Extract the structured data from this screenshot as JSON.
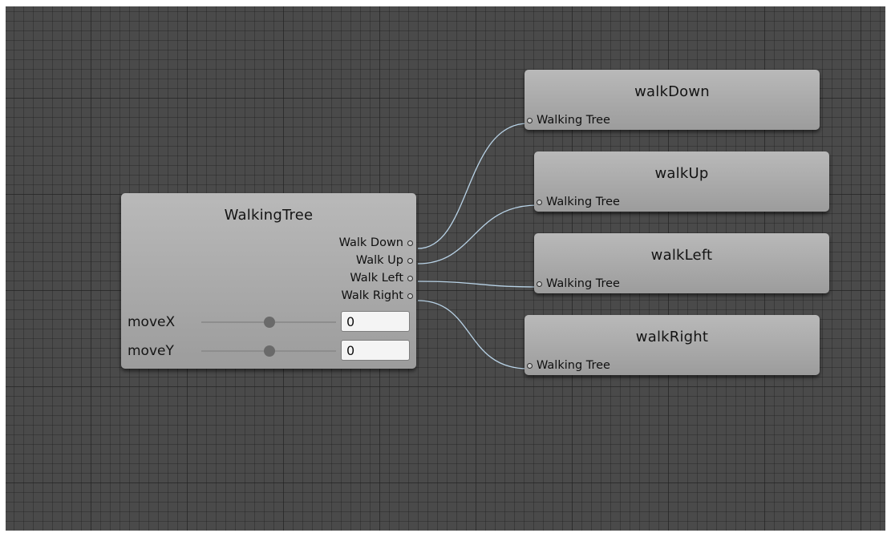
{
  "graph": {
    "blend_tree": {
      "title": "WalkingTree",
      "outputs": [
        "Walk Down",
        "Walk Up",
        "Walk Left",
        "Walk Right"
      ],
      "params": [
        {
          "label": "moveX",
          "value": "0",
          "slider_fraction": 0.5
        },
        {
          "label": "moveY",
          "value": "0",
          "slider_fraction": 0.5
        }
      ]
    },
    "states": [
      {
        "title": "walkDown",
        "input_label": "Walking Tree"
      },
      {
        "title": "walkUp",
        "input_label": "Walking Tree"
      },
      {
        "title": "walkLeft",
        "input_label": "Walking Tree"
      },
      {
        "title": "walkRight",
        "input_label": "Walking Tree"
      }
    ],
    "colors": {
      "wire": "#b8d2e6",
      "canvas": "#4a4a4a",
      "node": "#ababab"
    }
  }
}
